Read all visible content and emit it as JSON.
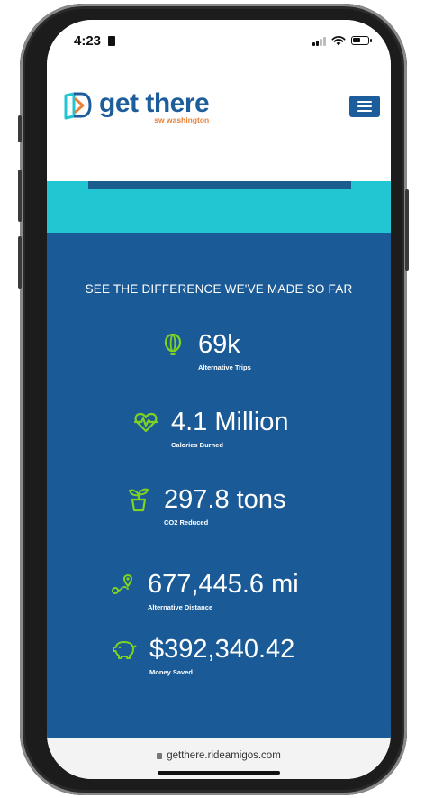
{
  "status_bar": {
    "time": "4:23"
  },
  "header": {
    "logo_text": "get there",
    "logo_subtext": "sw washington",
    "menu_icon": "hamburger-menu-icon"
  },
  "colors": {
    "brand_blue": "#1d5d9b",
    "brand_orange": "#e8823a",
    "teal": "#22c6d3",
    "section_blue": "#1a5a96",
    "icon_green": "#7ed321"
  },
  "stats": {
    "heading": "SEE THE DIFFERENCE WE'VE MADE SO FAR",
    "items": [
      {
        "icon": "balloon-icon",
        "value": "69k",
        "label": "Alternative Trips"
      },
      {
        "icon": "heartbeat-icon",
        "value": "4.1 Million",
        "label": "Calories Burned"
      },
      {
        "icon": "plant-icon",
        "value": "297.8 tons",
        "label": "CO2 Reduced"
      },
      {
        "icon": "route-icon",
        "value": "677,445.6 mi",
        "label": "Alternative Distance"
      },
      {
        "icon": "piggy-bank-icon",
        "value": "$392,340.42",
        "label": "Money Saved"
      }
    ]
  },
  "browser": {
    "url": "getthere.rideamigos.com"
  }
}
